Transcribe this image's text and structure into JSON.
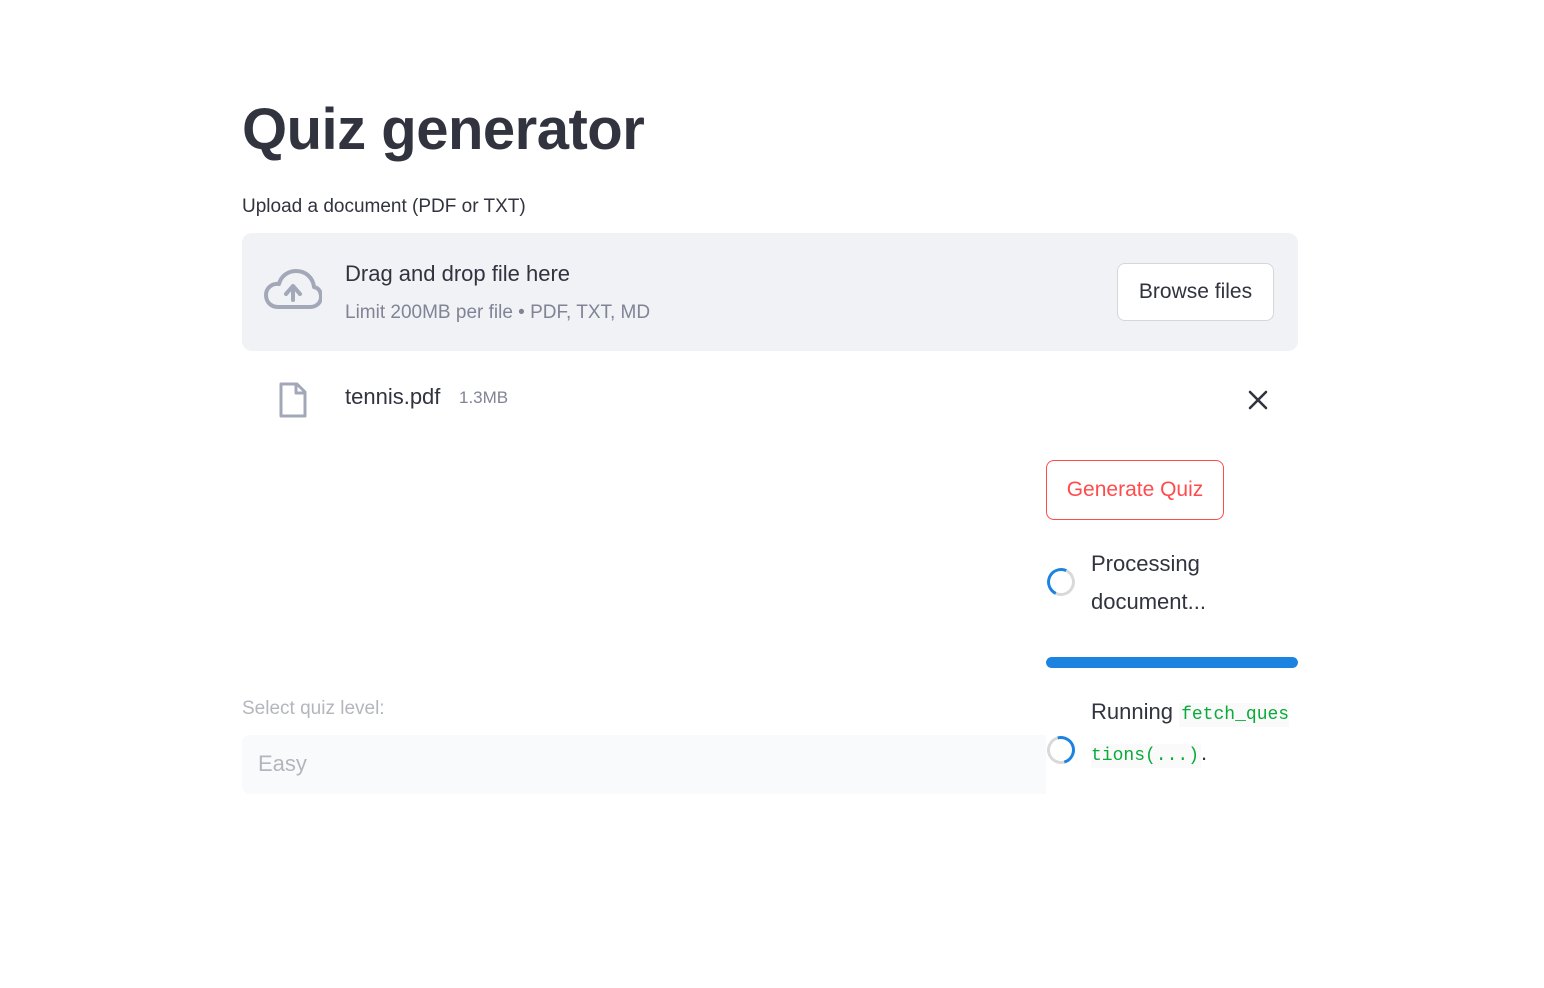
{
  "page": {
    "title": "Quiz generator"
  },
  "uploader": {
    "label": "Upload a document (PDF or TXT)",
    "drop_title": "Drag and drop file here",
    "drop_subtitle": "Limit 200MB per file • PDF, TXT, MD",
    "browse_label": "Browse files",
    "icon": "cloud-upload-icon"
  },
  "uploaded_file": {
    "name": "tennis.pdf",
    "size": "1.3MB",
    "icon": "file-icon",
    "remove_icon": "close-icon"
  },
  "actions": {
    "generate_label": "Generate Quiz"
  },
  "status": {
    "processing_text": "Processing document...",
    "progress_percent": 100,
    "running_prefix": "Running",
    "running_code": "fetch_questions(...)",
    "running_suffix": "."
  },
  "quiz_level": {
    "label": "Select quiz level:",
    "selected": "Easy"
  },
  "colors": {
    "text": "#31333f",
    "muted": "#808495",
    "accent_red": "#ff4b4b",
    "progress_blue": "#1c83e1",
    "code_green": "#09ab3b",
    "dropzone_bg": "#f0f2f6"
  }
}
